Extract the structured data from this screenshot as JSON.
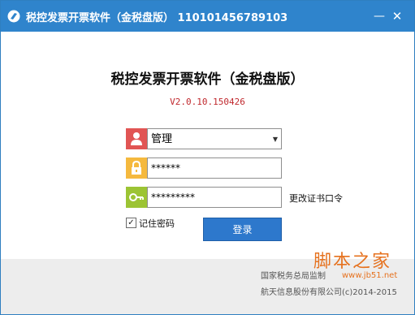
{
  "window": {
    "title": "税控发票开票软件（金税盘版） 110101456789103",
    "minimize_glyph": "—",
    "close_glyph": "✕"
  },
  "header": {
    "app_name": "税控发票开票软件（金税盘版）",
    "version": "V2.0.10.150426"
  },
  "form": {
    "user": {
      "icon": "user-icon",
      "value": "管理",
      "arrow": "▼"
    },
    "password": {
      "icon": "lock-icon",
      "value": "******"
    },
    "cert_password": {
      "icon": "key-icon",
      "value": "*********"
    },
    "change_cert_link": "更改证书口令",
    "remember": {
      "checked": true,
      "mark": "☑",
      "label": "记住密码"
    },
    "login_button": "登录"
  },
  "footer": {
    "supervisor": "国家税务总局监制",
    "copyright": "航天信息股份有限公司(c)2014-2015"
  },
  "watermark": {
    "logo": "脚本之家",
    "url": "www.jb51.net"
  },
  "colors": {
    "titlebar": "#2f84cc",
    "user_icon_bg": "#e15554",
    "lock_icon_bg": "#f5b93e",
    "key_icon_bg": "#9cc434",
    "login_button": "#2d78cc",
    "version_text": "#c0282d"
  }
}
